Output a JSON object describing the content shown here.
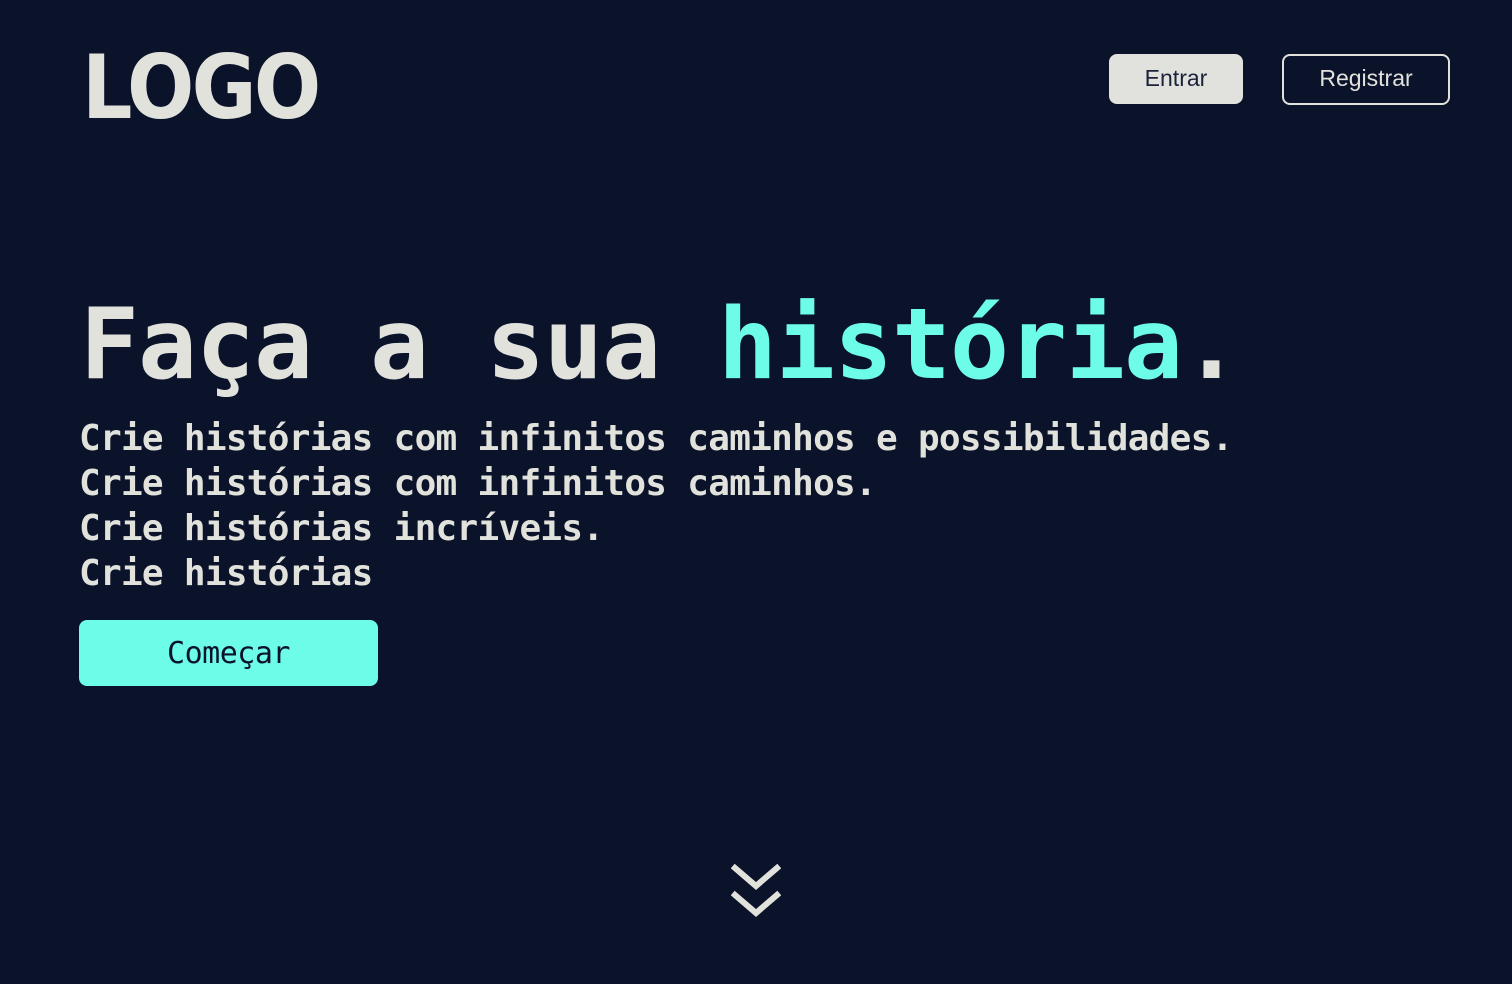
{
  "header": {
    "logo_text": "LOGO",
    "login_label": "Entrar",
    "register_label": "Registrar"
  },
  "hero": {
    "title_prefix": "Faça a sua ",
    "title_highlight": "história",
    "title_suffix": ".",
    "lines": [
      "Crie histórias com infinitos caminhos e possibilidades.",
      "Crie histórias com infinitos caminhos.",
      "Crie histórias incríveis.",
      "Crie histórias"
    ],
    "cta_label": "Começar"
  },
  "scroll": {
    "icon": "double-chevron-down-icon"
  },
  "colors": {
    "background": "#0b132b",
    "text": "#e2e2dd",
    "accent": "#6cfce8"
  }
}
